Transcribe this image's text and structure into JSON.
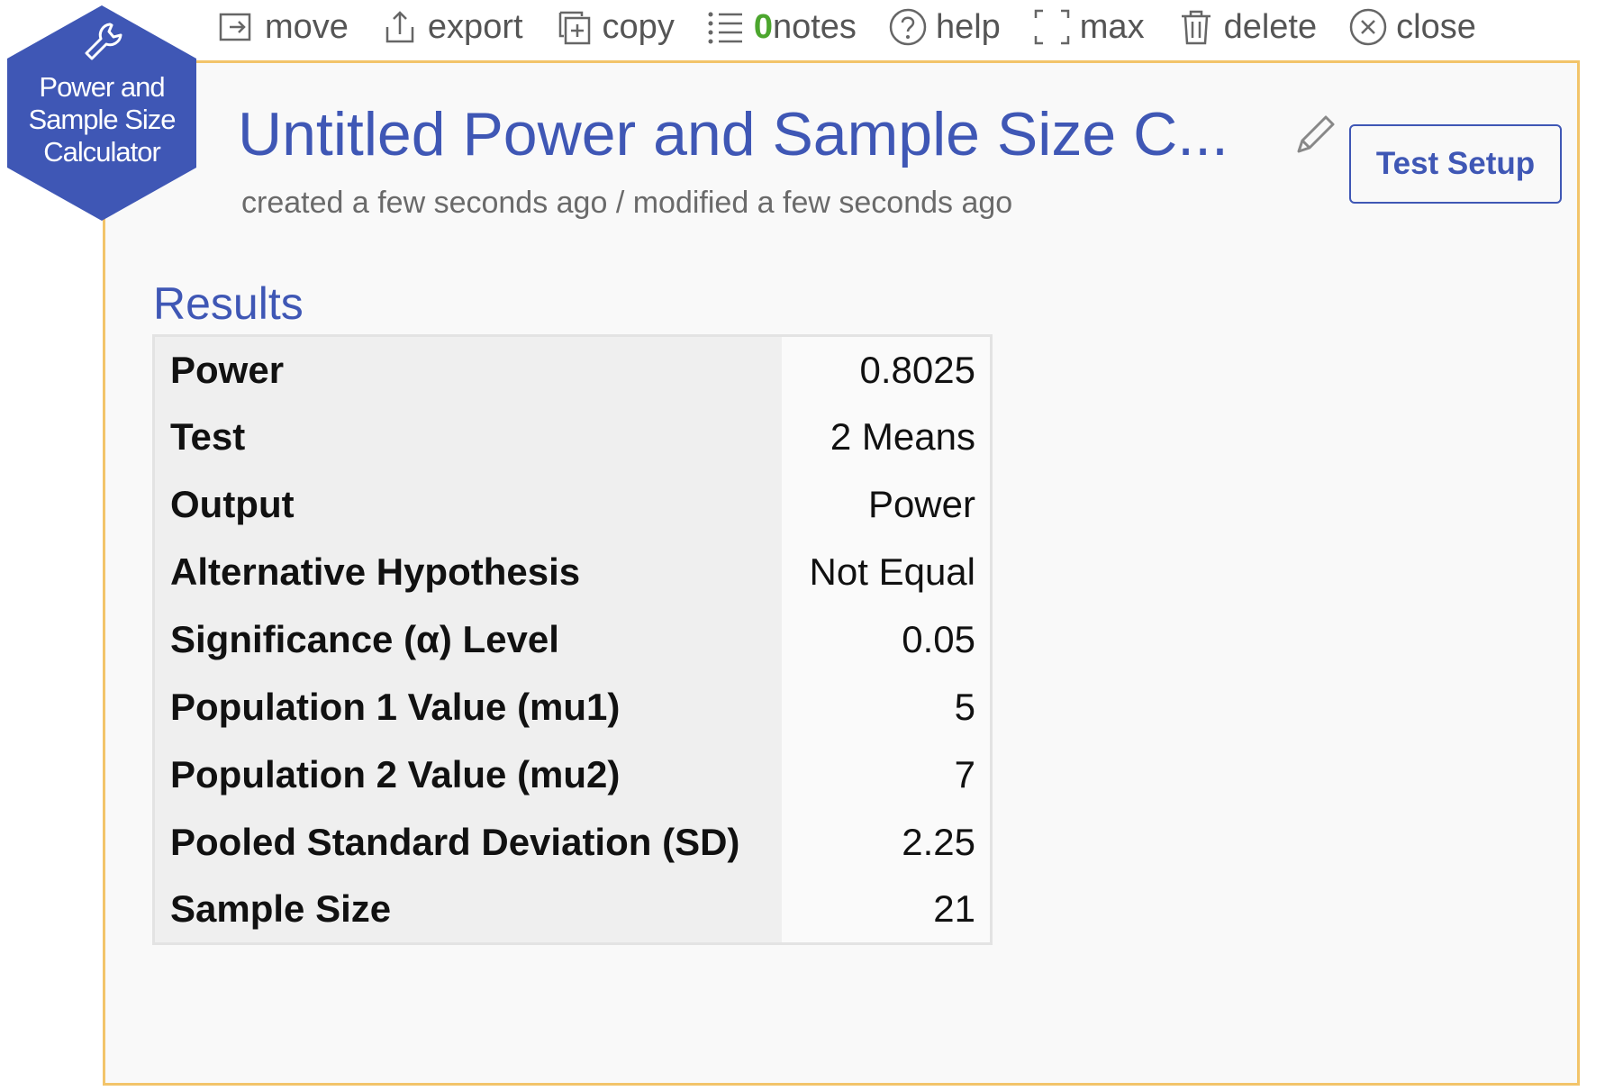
{
  "toolbar": {
    "items": [
      {
        "label": "move",
        "icon": "move-icon"
      },
      {
        "label": "export",
        "icon": "export-icon"
      },
      {
        "label": "copy",
        "icon": "copy-icon"
      },
      {
        "notes_count": "0",
        "label": "notes",
        "icon": "list-icon"
      },
      {
        "label": "help",
        "icon": "help-icon"
      },
      {
        "label": "max",
        "icon": "maximize-icon"
      },
      {
        "label": "delete",
        "icon": "trash-icon"
      },
      {
        "label": "close",
        "icon": "close-icon"
      }
    ]
  },
  "badge": {
    "label": "Power and Sample Size Calculator",
    "icon": "wrench-icon",
    "color": "#3f57b5"
  },
  "header": {
    "title": "Untitled Power and Sample Size C...",
    "subtitle": "created a few seconds ago / modified a few seconds ago",
    "setup_button": "Test Setup",
    "edit_icon": "pencil-icon"
  },
  "results": {
    "heading": "Results",
    "rows": [
      {
        "label": "Power",
        "value": "0.8025"
      },
      {
        "label": "Test",
        "value": "2 Means"
      },
      {
        "label": "Output",
        "value": "Power"
      },
      {
        "label": "Alternative Hypothesis",
        "value": "Not Equal"
      },
      {
        "label": "Significance (α) Level",
        "value": "0.05"
      },
      {
        "label": "Population 1 Value (mu1)",
        "value": "5"
      },
      {
        "label": "Population 2 Value (mu2)",
        "value": "7"
      },
      {
        "label": "Pooled Standard Deviation (SD)",
        "value": "2.25"
      },
      {
        "label": "Sample Size",
        "value": "21"
      }
    ]
  },
  "colors": {
    "accent": "#3f57b5",
    "panel_border": "#f2c46a",
    "notes_count": "#4ca62e"
  }
}
